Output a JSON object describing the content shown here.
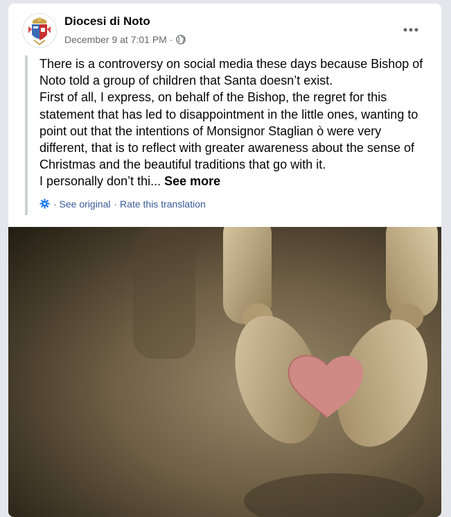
{
  "post": {
    "page_name": "Diocesi di Noto",
    "timestamp": "December 9 at 7:01 PM",
    "separator": "·",
    "privacy_icon": "globe-icon",
    "more_icon": "ellipsis-icon",
    "paragraphs": [
      "There is a controversy on social media these days because Bishop of Noto told a group of children that Santa doesn’t exist.",
      "First of all, I express, on behalf of the Bishop, the regret for this statement that has led to disappointment in the little ones, wanting to point out that the intentions of Monsignor Staglian ò were very different, that is to reflect with greater awareness about the sense of Christmas and the beautiful traditions that go with it."
    ],
    "truncated_text": "I personally don’t thi...",
    "see_more": "See more"
  },
  "translation": {
    "icon": "gear-icon",
    "see_original": "· See original",
    "rate": "· Rate this translation"
  },
  "photo": {
    "description_icon": "wooden-hands-holding-heart-image"
  },
  "colors": {
    "text": "#050505",
    "meta": "#65676b",
    "link": "#385898",
    "quote_bar": "#ced0d4",
    "background": "#e4e6eb"
  }
}
